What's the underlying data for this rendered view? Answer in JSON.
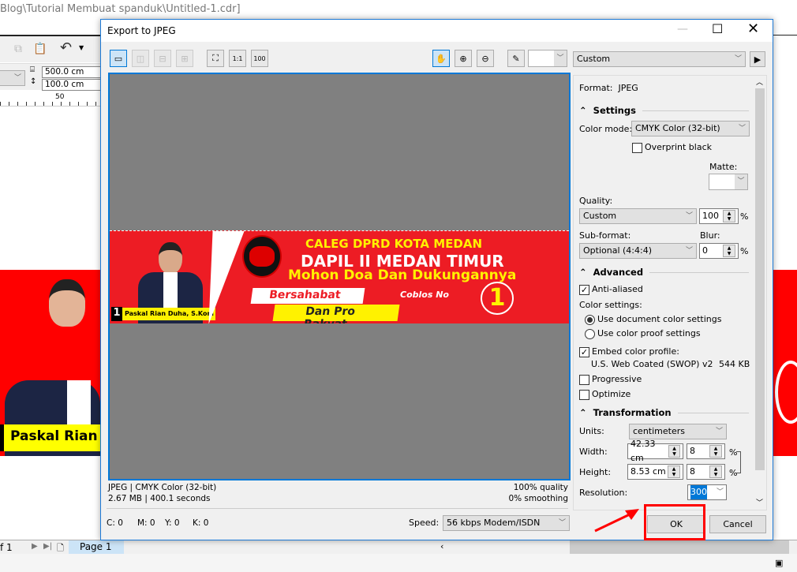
{
  "app": {
    "title": "Blog\\Tutorial Membuat spanduk\\Untitled-1.cdr]",
    "width": "500.0 cm",
    "height": "100.0 cm",
    "ruler_label": "50",
    "page_of": "f 1",
    "page_tab": "Page 1",
    "banner_name_partial": "Paskal Rian"
  },
  "dialog": {
    "title": "Export to JPEG",
    "preset": "Custom",
    "preview": {
      "banner": {
        "line1": "CALEG DPRD KOTA MEDAN",
        "line2": "DAPIL II MEDAN TIMUR",
        "line3": "Mohon Doa Dan Dukungannya",
        "tag1": "Bersahabat",
        "tag2": "Dan Pro Rakyat",
        "coblos": "Coblos No",
        "number": "1",
        "name_no": "1",
        "name": "Paskal Rian Duha, S.Kom"
      }
    },
    "info": {
      "format_line": "JPEG | CMYK Color (32-bit)",
      "size_line": "2.67 MB | 400.1 seconds",
      "quality": "100% quality",
      "smoothing": "0% smoothing"
    },
    "status": {
      "c": "C: 0",
      "m": "M: 0",
      "y": "Y: 0",
      "k": "K: 0",
      "speed_label": "Speed:",
      "speed": "56 kbps Modem/ISDN"
    },
    "panel": {
      "format_label": "Format:",
      "format": "JPEG",
      "settings": "Settings",
      "color_mode_label": "Color mode:",
      "color_mode": "CMYK Color (32-bit)",
      "overprint": "Overprint black",
      "matte": "Matte:",
      "quality_label": "Quality:",
      "quality": "Custom",
      "quality_value": "100",
      "pct": "%",
      "subformat_label": "Sub-format:",
      "subformat": "Optional (4:4:4)",
      "blur_label": "Blur:",
      "blur": "0",
      "advanced": "Advanced",
      "anti_aliased": "Anti-aliased",
      "color_settings": "Color settings:",
      "use_doc": "Use document color settings",
      "use_proof": "Use color proof settings",
      "embed": "Embed color profile:",
      "profile": "U.S. Web Coated (SWOP) v2",
      "profile_size": "544 KB",
      "progressive": "Progressive",
      "optimize": "Optimize",
      "transformation": "Transformation",
      "units_label": "Units:",
      "units": "centimeters",
      "width_label": "Width:",
      "width": "42.33 cm",
      "width_pct": "8",
      "height_label": "Height:",
      "height": "8.53 cm",
      "height_pct": "8",
      "resolution_label": "Resolution:",
      "resolution": "300"
    },
    "ok": "OK",
    "cancel": "Cancel"
  },
  "colors": {
    "accent": "#0078d7",
    "highlight": "#ff0000",
    "banner_red": "#ed1c24",
    "banner_yellow": "#fff200"
  }
}
